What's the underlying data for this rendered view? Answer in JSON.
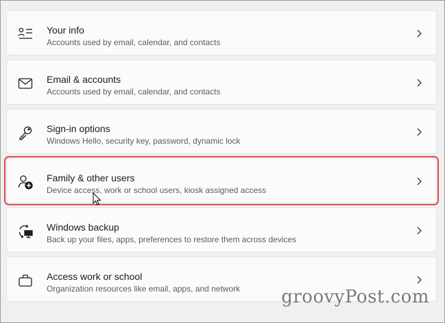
{
  "settings_list": {
    "items": [
      {
        "icon": "user-info-icon",
        "title": "Your info",
        "subtitle": "Accounts used by email, calendar, and contacts"
      },
      {
        "icon": "mail-icon",
        "title": "Email & accounts",
        "subtitle": "Accounts used by email, calendar, and contacts"
      },
      {
        "icon": "key-icon",
        "title": "Sign-in options",
        "subtitle": "Windows Hello, security key, password, dynamic lock"
      },
      {
        "icon": "add-user-icon",
        "title": "Family & other users",
        "subtitle": "Device access, work or school users, kiosk assigned access",
        "highlighted": true
      },
      {
        "icon": "backup-sync-icon",
        "title": "Windows backup",
        "subtitle": "Back up your files, apps, preferences to restore them across devices"
      },
      {
        "icon": "briefcase-icon",
        "title": "Access work or school",
        "subtitle": "Organization resources like email, apps, and network"
      }
    ]
  },
  "highlight_color": "#e14b4b",
  "watermark": "groovyPost.com"
}
